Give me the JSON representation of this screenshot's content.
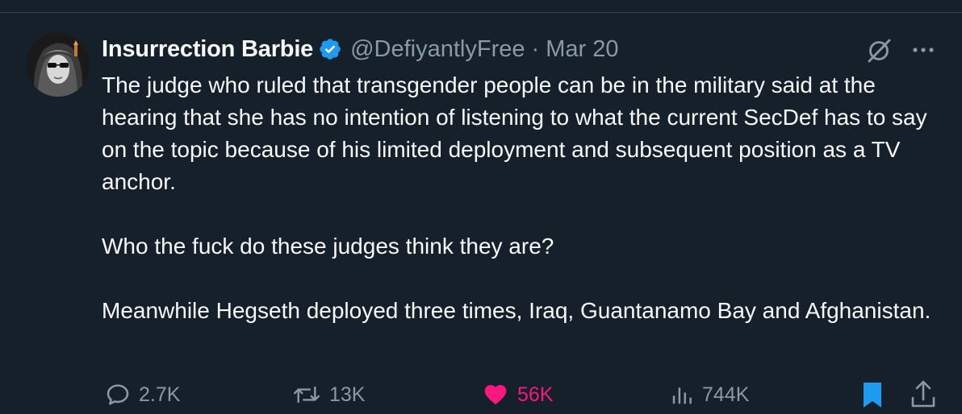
{
  "tweet": {
    "display_name": "Insurrection Barbie",
    "handle": "@DefiyantlyFree",
    "separator": "·",
    "date": "Mar 20",
    "paragraphs": [
      "The judge who ruled that transgender people can be in the military said at the hearing that she has no intention of listening to what the current SecDef has to say on the topic because of his limited deployment and subsequent position as a TV anchor.",
      "Who the fuck do these judges think they are?",
      "Meanwhile Hegseth deployed three times, Iraq, Guantanamo Bay and Afghanistan."
    ]
  },
  "actions": {
    "replies": "2.7K",
    "retweets": "13K",
    "likes": "56K",
    "views": "744K"
  },
  "icons": {
    "verified": "verified-badge-icon",
    "grok": "grok-icon",
    "more": "more-icon",
    "reply": "reply-icon",
    "retweet": "retweet-icon",
    "like": "heart-icon",
    "views": "views-icon",
    "bookmark": "bookmark-icon",
    "share": "share-icon"
  },
  "colors": {
    "background": "#15202b",
    "text": "#f7f9f9",
    "secondary_text": "#8b98a5",
    "accent_blue": "#1d9bf0",
    "like_pink": "#f91880"
  }
}
